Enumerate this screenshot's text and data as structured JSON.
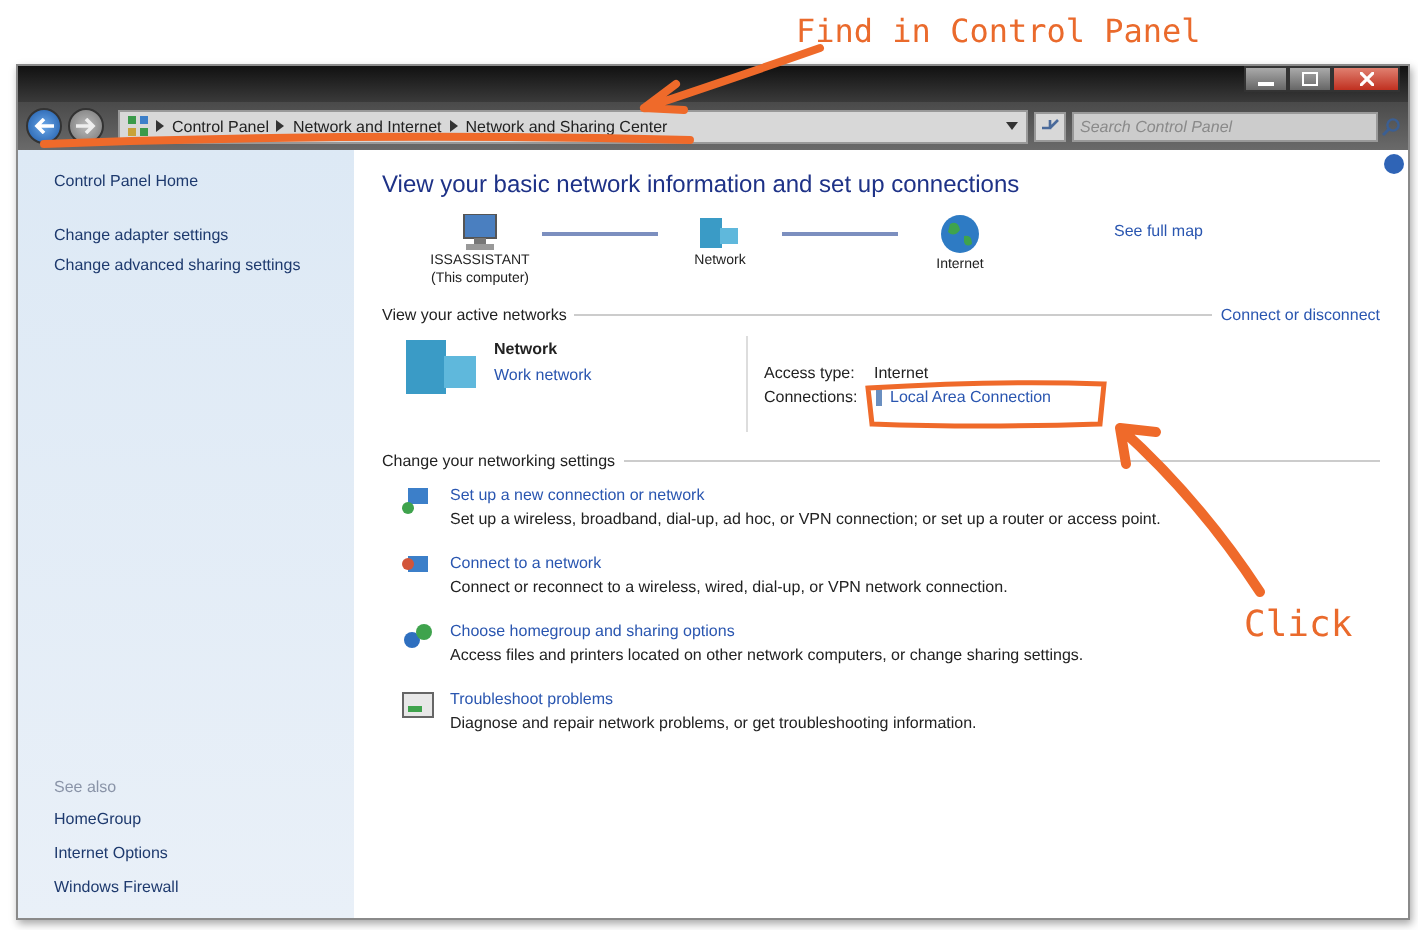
{
  "address_bar": {
    "breadcrumbs": [
      "Control Panel",
      "Network and Internet",
      "Network and Sharing Center"
    ]
  },
  "search": {
    "placeholder": "Search Control Panel"
  },
  "sidebar": {
    "items": [
      {
        "label": "Control Panel Home",
        "kind": "home"
      },
      {
        "label": "Change adapter settings",
        "kind": "link"
      },
      {
        "label": "Change advanced sharing settings",
        "kind": "link"
      }
    ],
    "see_also": {
      "title": "See also",
      "items": [
        "HomeGroup",
        "Internet Options",
        "Windows Firewall"
      ]
    }
  },
  "main": {
    "title": "View your basic network information and set up connections",
    "map": {
      "nodes": [
        {
          "name": "ISSASSISTANT",
          "subtitle": "(This computer)",
          "kind": "computer"
        },
        {
          "name": "Network",
          "kind": "network"
        },
        {
          "name": "Internet",
          "kind": "internet"
        }
      ],
      "link": "See full map"
    },
    "active_networks": {
      "title": "View your active networks",
      "action": "Connect or disconnect",
      "network": {
        "name": "Network",
        "type": "Work network"
      },
      "access_type_label": "Access type:",
      "access_type": "Internet",
      "connections_label": "Connections:",
      "connection": "Local Area Connection"
    },
    "settings": {
      "title": "Change your networking settings",
      "items": [
        {
          "kind": "new-connection",
          "title": "Set up a new connection or network",
          "description": "Set up a wireless, broadband, dial-up, ad hoc, or VPN connection; or set up a router or access point."
        },
        {
          "kind": "connect",
          "title": "Connect to a network",
          "description": "Connect or reconnect to a wireless, wired, dial-up, or VPN network connection."
        },
        {
          "kind": "homegroup",
          "title": "Choose homegroup and sharing options",
          "description": "Access files and printers located on other network computers, or change sharing settings."
        },
        {
          "kind": "troubleshoot",
          "title": "Troubleshoot problems",
          "description": "Diagnose and repair network problems, or get troubleshooting information."
        }
      ]
    }
  },
  "annotations": [
    {
      "kind": "top",
      "text": "Find in Control Panel"
    },
    {
      "kind": "right",
      "text": "Click"
    }
  ]
}
